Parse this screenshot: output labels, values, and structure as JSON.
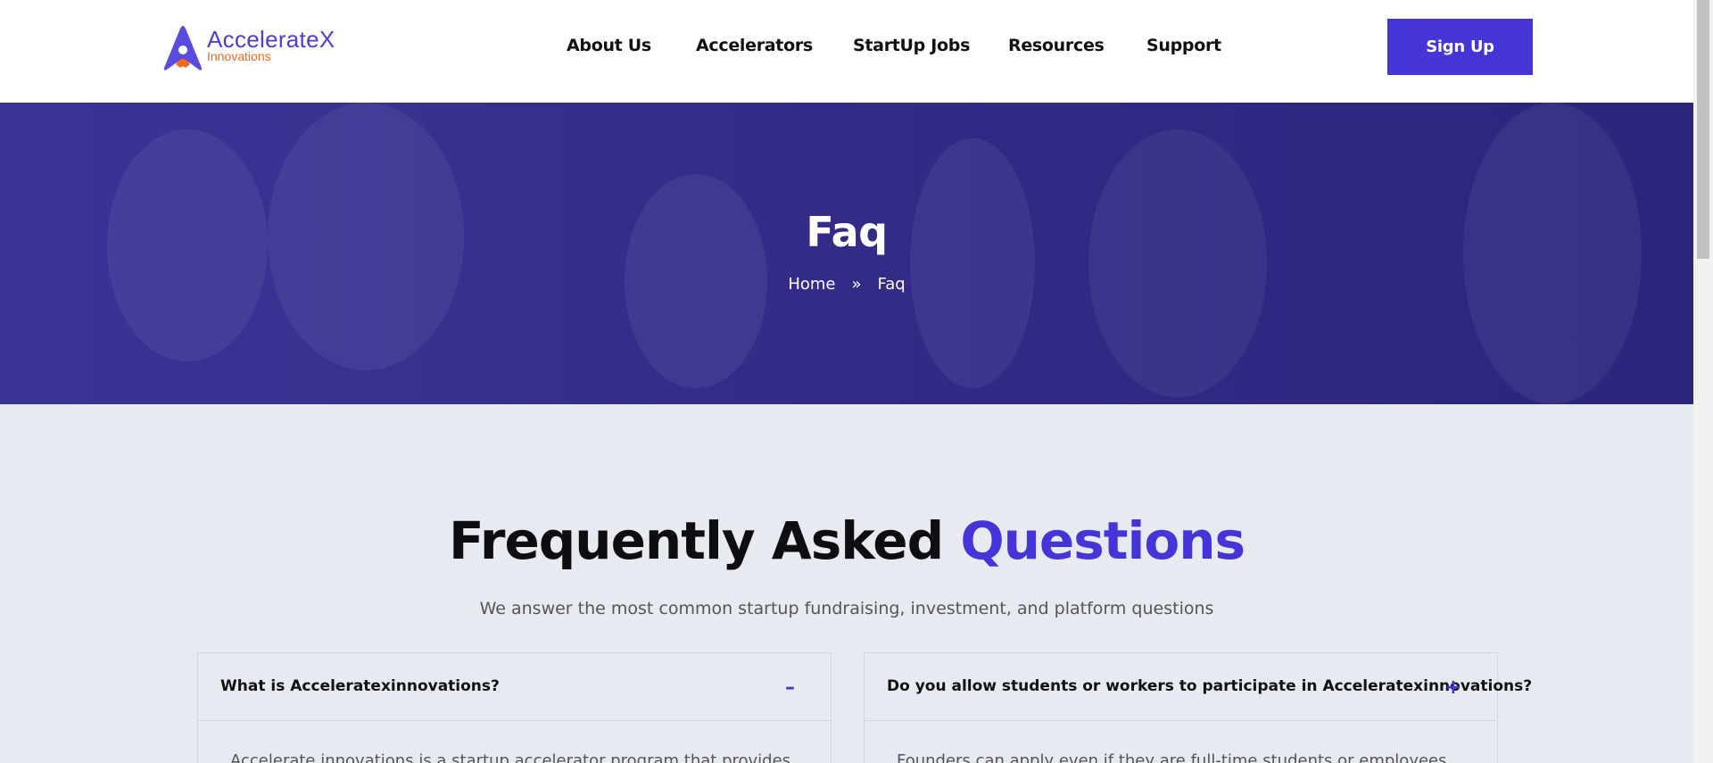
{
  "header": {
    "logo": {
      "main": "AccelerateX",
      "sub": "Innovations"
    },
    "nav": [
      "About Us",
      "Accelerators",
      "StartUp Jobs",
      "Resources",
      "Support"
    ],
    "signup_label": "Sign Up"
  },
  "hero": {
    "title": "Faq",
    "breadcrumb": {
      "home": "Home",
      "separator": "»",
      "current": "Faq"
    }
  },
  "faq_section": {
    "title_main": "Frequently Asked ",
    "title_accent": "Questions",
    "subtitle": "We answer the most common startup fundraising, investment, and platform questions",
    "items": [
      {
        "question": "What is Acceleratexinnovations?",
        "toggle": "–",
        "answer_preview": "Accelerate innovations is a startup accelerator program that provides"
      },
      {
        "question": "Do you allow students or workers to participate in Acceleratexinnovations?",
        "toggle": "+",
        "answer_preview": "Founders can apply even if they are full-time students or employees"
      }
    ]
  },
  "colors": {
    "brand": "#4535d9",
    "accent_orange": "#f06a1b",
    "hero_bg": "#36308d",
    "page_bg": "#e8eaf1"
  }
}
